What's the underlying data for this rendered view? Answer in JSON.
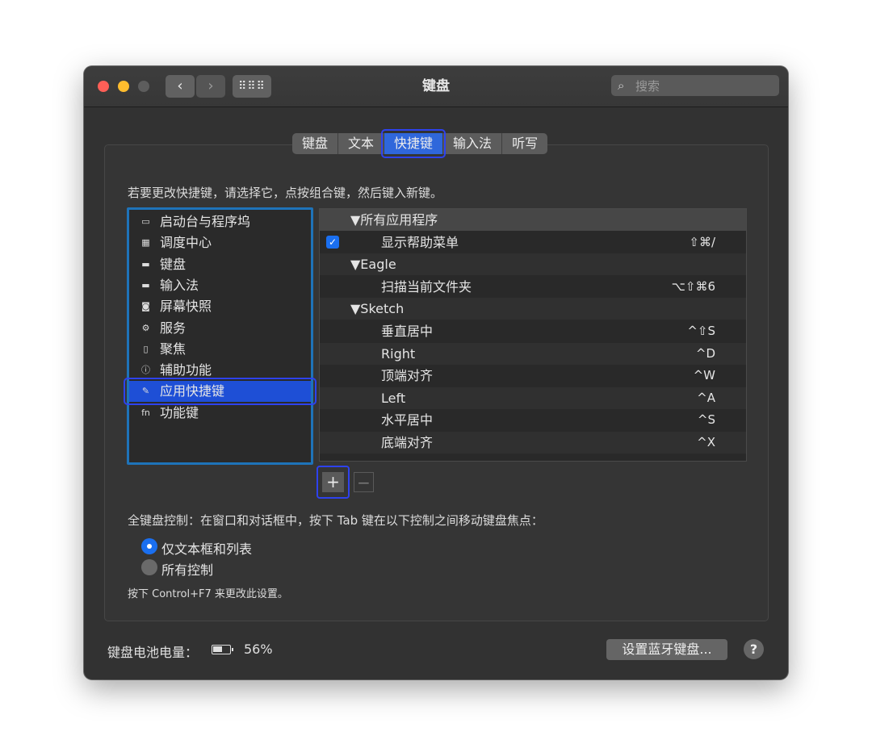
{
  "window": {
    "title": "键盘",
    "search_placeholder": "搜索",
    "nav_back": "‹",
    "nav_forward": "›",
    "nav_grid": "⠿⠿⠿"
  },
  "tabs": [
    {
      "label": "键盘"
    },
    {
      "label": "文本"
    },
    {
      "label": "快捷键",
      "active": true
    },
    {
      "label": "输入法"
    },
    {
      "label": "听写"
    }
  ],
  "instruction": "若要更改快捷键，请选择它，点按组合键，然后键入新键。",
  "categories": [
    {
      "label": "启动台与程序坞",
      "icon": "launchpad-icon"
    },
    {
      "label": "调度中心",
      "icon": "mission-control-icon"
    },
    {
      "label": "键盘",
      "icon": "keyboard-icon"
    },
    {
      "label": "输入法",
      "icon": "input-method-icon"
    },
    {
      "label": "屏幕快照",
      "icon": "screenshot-icon"
    },
    {
      "label": "服务",
      "icon": "gear-icon"
    },
    {
      "label": "聚焦",
      "icon": "spotlight-icon"
    },
    {
      "label": "辅助功能",
      "icon": "accessibility-icon"
    },
    {
      "label": "应用快捷键",
      "icon": "app-shortcuts-icon",
      "selected": true
    },
    {
      "label": "功能键",
      "icon": "fn-key-icon"
    }
  ],
  "shortcuts": [
    {
      "type": "group",
      "label": "▼所有应用程序"
    },
    {
      "type": "item",
      "label": "显示帮助菜单",
      "key": "⇧⌘/",
      "checked": true
    },
    {
      "type": "group",
      "label": "▼Eagle"
    },
    {
      "type": "item",
      "label": "扫描当前文件夹",
      "key": "⌥⇧⌘6"
    },
    {
      "type": "group",
      "label": "▼Sketch"
    },
    {
      "type": "item",
      "label": "垂直居中",
      "key": "^⇧S"
    },
    {
      "type": "item",
      "label": "Right",
      "key": "^D"
    },
    {
      "type": "item",
      "label": "顶端对齐",
      "key": "^W"
    },
    {
      "type": "item",
      "label": "Left",
      "key": "^A"
    },
    {
      "type": "item",
      "label": "水平居中",
      "key": "^S"
    },
    {
      "type": "item",
      "label": "底端对齐",
      "key": "^X"
    }
  ],
  "buttons": {
    "add": "+",
    "remove": "−",
    "bluetooth": "设置蓝牙键盘...",
    "help": "?"
  },
  "full_keyboard": {
    "label": "全键盘控制：在窗口和对话框中，按下 Tab 键在以下控制之间移动键盘焦点：",
    "option1": "仅文本框和列表",
    "option2": "所有控制",
    "selected": "option1"
  },
  "hint": "按下 Control+F7 来更改此设置。",
  "battery": {
    "label": "键盘电池电量：",
    "value": "56%",
    "level": 0.56
  },
  "colors": {
    "accent": "#1a6ff0",
    "highlight": "#2e42ee"
  }
}
